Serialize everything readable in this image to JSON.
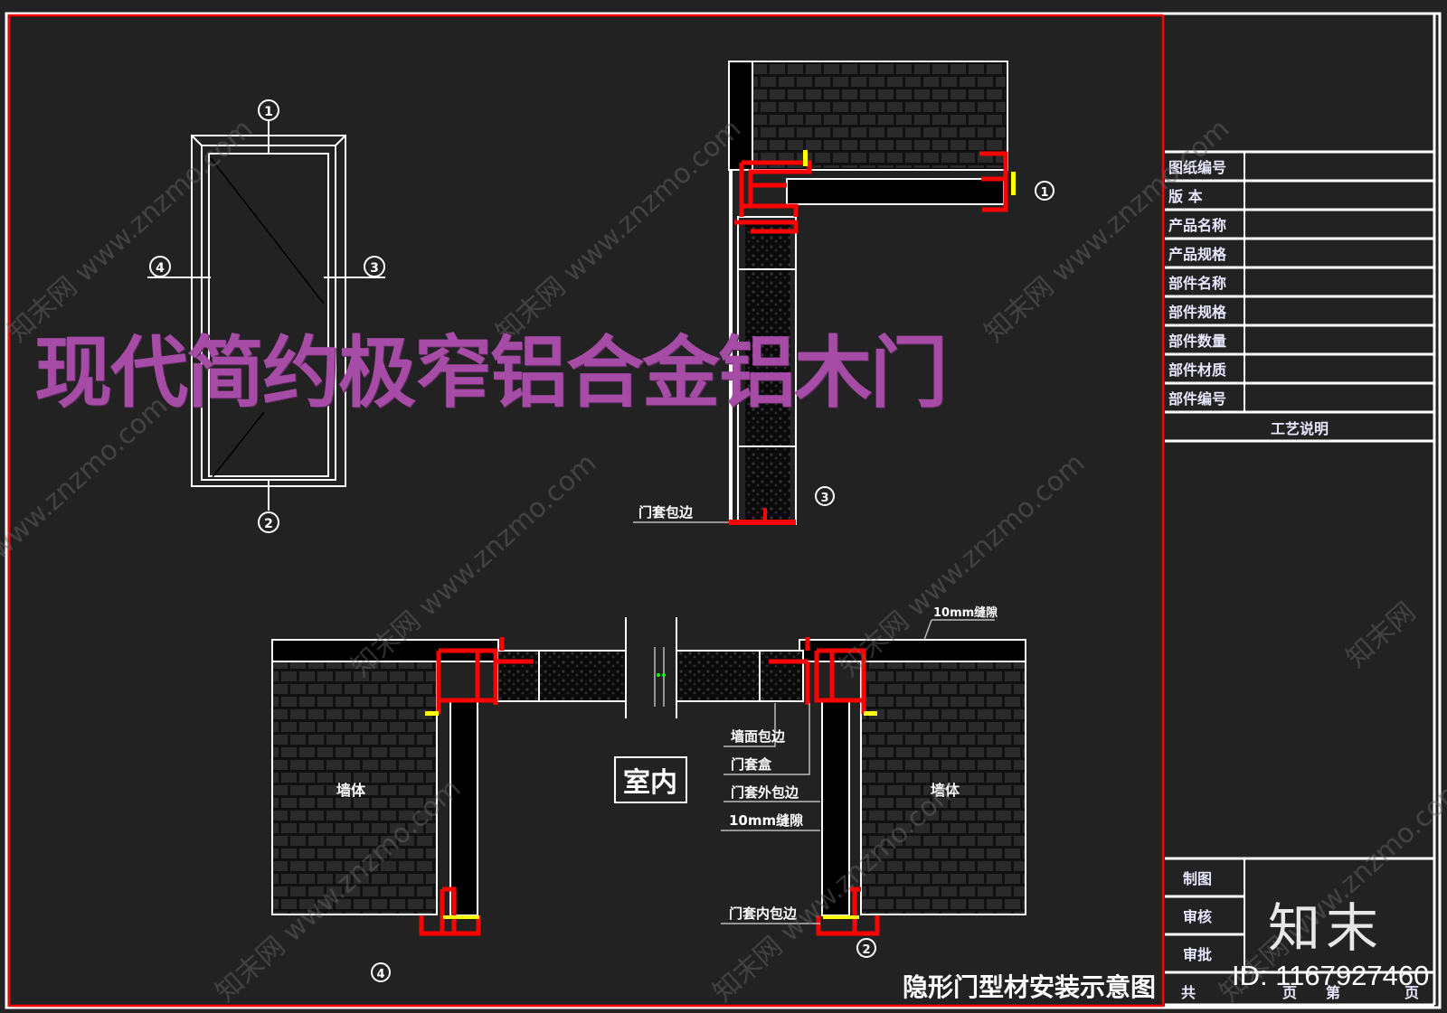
{
  "overlay_title": "现代简约极窄铝合金铝木门",
  "drawing_title": "隐形门型材安装示意图",
  "room_label": "室内",
  "wall_label_left": "墙体",
  "wall_label_right": "墙体",
  "callouts": {
    "detail1_note": "门套包边",
    "d2_note_top": "10mm缝隙",
    "d2_note_1": "墙面包边",
    "d2_note_2": "门套盒",
    "d2_note_3": "门套外包边",
    "d2_note_4": "10mm缝隙",
    "d2_note_5": "门套内包边"
  },
  "section_markers": {
    "elev_top": "1",
    "elev_left": "4",
    "elev_right": "3",
    "elev_bottom": "2",
    "detail_top_right": "1",
    "detail_mid_right": "3",
    "plan_bottom_left": "4",
    "plan_bottom_right": "2"
  },
  "title_block": {
    "rows": [
      {
        "label": "图纸编号",
        "value": ""
      },
      {
        "label": "版 本",
        "value": ""
      },
      {
        "label": "产品名称",
        "value": ""
      },
      {
        "label": "产品规格",
        "value": ""
      },
      {
        "label": "部件名称",
        "value": ""
      },
      {
        "label": "部件规格",
        "value": ""
      },
      {
        "label": "部件数量",
        "value": ""
      },
      {
        "label": "部件材质",
        "value": ""
      },
      {
        "label": "部件编号",
        "value": ""
      }
    ],
    "process_header": "工艺说明",
    "sign_rows": [
      {
        "label": "制图",
        "value": ""
      },
      {
        "label": "审核",
        "value": ""
      },
      {
        "label": "审批",
        "value": ""
      }
    ],
    "footer": {
      "total": "共",
      "page": "页",
      "nth": "第",
      "page2": "页"
    }
  },
  "watermark": {
    "text_url": "www.znzmo.com",
    "text_cn": "知末网",
    "brand": "知末",
    "id": "ID: 1167927460"
  },
  "colors": {
    "background": "#222222",
    "line": "#ffffff",
    "profile": "#ff0000",
    "fastener": "#ffff00",
    "title_overlay": "#a64ca6"
  }
}
